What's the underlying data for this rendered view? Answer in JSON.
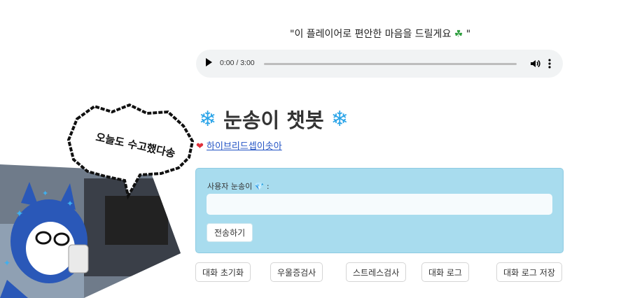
{
  "quote": {
    "text": "\"이 플레이어로 편안한 마음을 드릴게요",
    "clover": "☘",
    "end": " \""
  },
  "audio": {
    "time": "0:00 / 3:00",
    "progress": 0,
    "icons": [
      "play-icon",
      "volume-icon",
      "more-vert-icon"
    ]
  },
  "title": {
    "icon": "❄",
    "text": "눈송이 챗봇"
  },
  "link": {
    "heart": "❤",
    "text": "하이브리드셉이솟아"
  },
  "chat": {
    "label": "사용자 눈송이",
    "gem": "💎",
    "colon": " :",
    "input_value": "",
    "input_placeholder": "",
    "send_label": "전송하기"
  },
  "actions": {
    "reset": "대화 초기화",
    "depression": "우울증검사",
    "stress": "스트레스검사",
    "log": "대화 로그",
    "save_log": "대화 로그 저장"
  },
  "illustration": {
    "bubble_text": "오늘도 수고했다송"
  },
  "colors": {
    "chat_bg": "#a8dcee",
    "snow": "#2aa4e8",
    "link": "#2152c4",
    "heart": "#e0303a"
  }
}
